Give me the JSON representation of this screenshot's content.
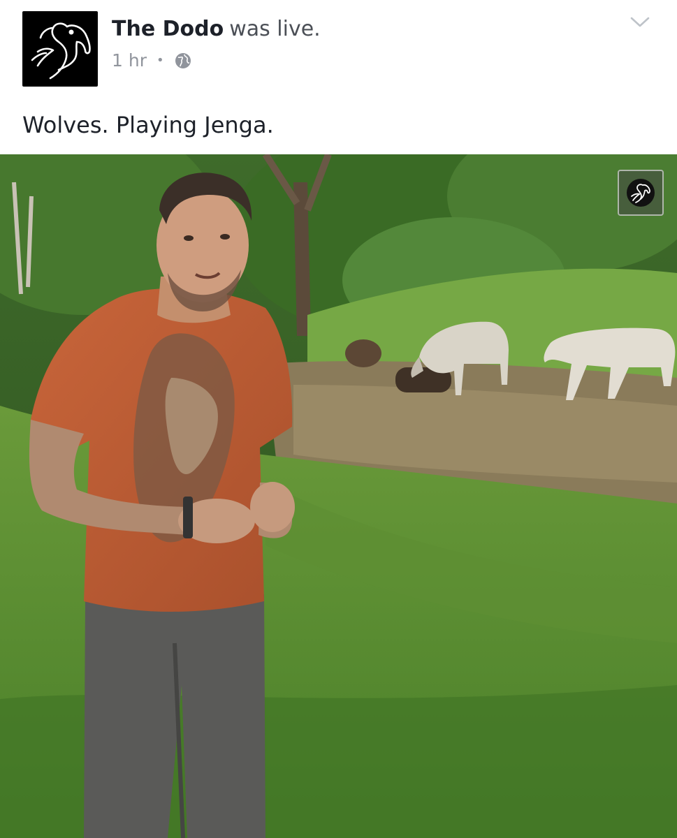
{
  "post": {
    "page_name": "The Dodo",
    "action": "was live.",
    "time": "1 hr",
    "separator": "•",
    "privacy_icon": "globe-icon",
    "menu_icon": "chevron-down-icon",
    "text": "Wolves. Playing Jenga."
  },
  "video": {
    "description_icon": "dodo-logo-icon"
  },
  "colors": {
    "avatar_bg": "#000000",
    "name": "#1d2129",
    "meta": "#90949c"
  }
}
